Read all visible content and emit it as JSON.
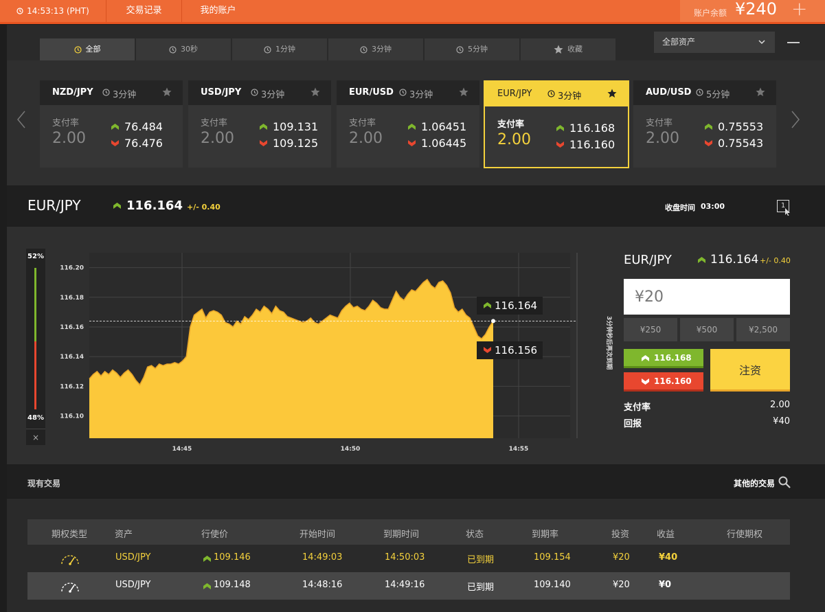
{
  "topbar": {
    "clock": "14:53:13 (PHT)",
    "nav_history": "交易记录",
    "nav_account": "我的账户",
    "balance_label": "账户余额",
    "balance_value": "¥240",
    "add_symbol": "+"
  },
  "tabs": [
    {
      "label": "全部",
      "icon": "clock-icon",
      "active": true
    },
    {
      "label": "30秒",
      "icon": "clock-icon"
    },
    {
      "label": "1分钟",
      "icon": "clock-icon"
    },
    {
      "label": "3分钟",
      "icon": "clock-icon"
    },
    {
      "label": "5分钟",
      "icon": "clock-icon"
    },
    {
      "label": "收藏",
      "icon": "star-icon"
    }
  ],
  "asset_select": {
    "value": "全部资产"
  },
  "cards": [
    {
      "pair": "NZD/JPY",
      "period": "3分钟",
      "payout_label": "支付率",
      "payout": "2.00",
      "up": "76.484",
      "down": "76.476"
    },
    {
      "pair": "USD/JPY",
      "period": "3分钟",
      "payout_label": "支付率",
      "payout": "2.00",
      "up": "109.131",
      "down": "109.125"
    },
    {
      "pair": "EUR/USD",
      "period": "3分钟",
      "payout_label": "支付率",
      "payout": "2.00",
      "up": "1.06451",
      "down": "1.06445"
    },
    {
      "pair": "EUR/JPY",
      "period": "3分钟",
      "payout_label": "支付率",
      "payout": "2.00",
      "up": "116.168",
      "down": "116.160",
      "selected": true
    },
    {
      "pair": "AUD/USD",
      "period": "5分钟",
      "payout_label": "支付率",
      "payout": "2.00",
      "up": "0.75553",
      "down": "0.75543"
    }
  ],
  "pairbar": {
    "pair": "EUR/JPY",
    "price": "116.164",
    "change": "+/- 0.40",
    "close_label": "收盘时间",
    "close_time": "03:00",
    "widget_number": "1"
  },
  "sentiment": {
    "up": "52%",
    "down": "48%",
    "close": "×",
    "up_fraction": 0.52
  },
  "chart_data": {
    "type": "area",
    "y_ticks": [
      "116.20",
      "116.18",
      "116.16",
      "116.14",
      "116.12",
      "116.10"
    ],
    "x_ticks": [
      "14:45",
      "14:50",
      "14:55"
    ],
    "current_up": "116.164",
    "current_down": "116.156",
    "side_label": "3分钟秒后再次到期",
    "series": [
      {
        "values": [
          116.125,
          116.128,
          116.13,
          116.127,
          116.13,
          116.128,
          116.131,
          116.129,
          116.126,
          116.129,
          116.131,
          116.128,
          116.124,
          116.121,
          116.126,
          116.133,
          116.134,
          116.132,
          116.135,
          116.134,
          116.135,
          116.135,
          116.136,
          116.135,
          116.137,
          116.14,
          116.16,
          116.168,
          116.17,
          116.172,
          116.166,
          116.17,
          116.171,
          116.17,
          116.168,
          116.163,
          116.162,
          116.16,
          116.164,
          116.162,
          116.167,
          116.165,
          116.168,
          116.172,
          116.17,
          116.174,
          116.172,
          116.169,
          116.174,
          116.171,
          116.17,
          116.167,
          116.166,
          116.165,
          116.164,
          116.163,
          116.164,
          116.166,
          116.163,
          116.162,
          116.164,
          116.166,
          116.168,
          116.167,
          116.166,
          116.171,
          116.174,
          116.176,
          116.173,
          116.174,
          116.172,
          116.171,
          116.174,
          116.178,
          116.176,
          116.173,
          116.172,
          116.172,
          116.178,
          116.184,
          116.18,
          116.178,
          116.182,
          116.185,
          116.184,
          116.187,
          116.19,
          116.192,
          116.188,
          116.186,
          116.19,
          116.191,
          116.188,
          116.183,
          116.173,
          116.17,
          116.172,
          116.168,
          116.166,
          116.16,
          116.154,
          116.152,
          116.155,
          116.16,
          116.164
        ]
      }
    ],
    "ylim": [
      116.085,
      116.21
    ]
  },
  "order": {
    "pair": "EUR/JPY",
    "price": "116.164",
    "change": "+/- 0.40",
    "amount": "¥20",
    "presets": [
      "¥250",
      "¥500",
      "¥2,500"
    ],
    "up": "116.168",
    "down": "116.160",
    "invest_label": "注资",
    "payout_label": "支付率",
    "payout_value": "2.00",
    "return_label": "回报",
    "return_value": "¥40"
  },
  "trades": {
    "title": "现有交易",
    "others_label": "其他的交易",
    "columns": [
      "期权类型",
      "资产",
      "行使价",
      "开始时间",
      "到期时间",
      "状态",
      "到期率",
      "投资",
      "收益",
      "行使期权"
    ],
    "rows": [
      {
        "asset": "USD/JPY",
        "strike": "109.146",
        "start": "14:49:03",
        "expiry": "14:50:03",
        "status": "已到期",
        "rate": "109.154",
        "invest": "¥20",
        "profit": "¥40"
      },
      {
        "asset": "USD/JPY",
        "strike": "109.148",
        "start": "14:48:16",
        "expiry": "14:49:16",
        "status": "已到期",
        "rate": "109.140",
        "invest": "¥20",
        "profit": "¥0"
      }
    ]
  },
  "colors": {
    "accent": "#ee6a35",
    "yellow": "#f5d23c",
    "green": "#7fb72d",
    "red": "#e8472f"
  }
}
